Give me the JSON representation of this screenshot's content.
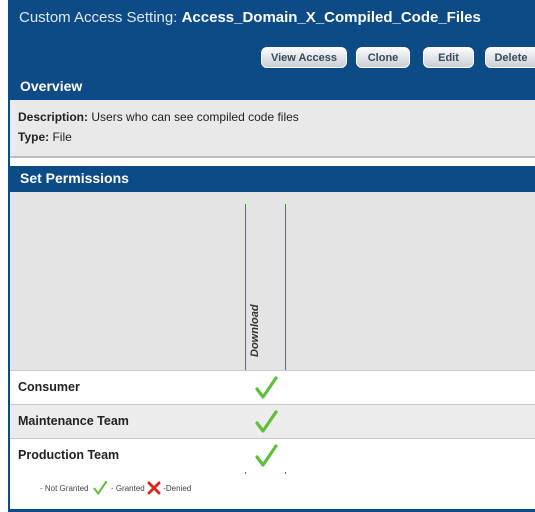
{
  "window": {
    "title_prefix": "Custom Access Setting: ",
    "title_name": "Access_Domain_X_Compiled_Code_Files"
  },
  "toolbar": {
    "view_access": "View Access",
    "clone": "Clone",
    "edit": "Edit",
    "delete": "Delete"
  },
  "overview": {
    "header": "Overview",
    "description_label": "Description:",
    "description_value": "Users who can see compiled code files",
    "type_label": "Type:",
    "type_value": "File"
  },
  "permissions": {
    "header": "Set Permissions",
    "column": "Download",
    "rows": [
      {
        "label": "Consumer",
        "download": "granted"
      },
      {
        "label": "Maintenance Team",
        "download": "granted"
      },
      {
        "label": "Production Team",
        "download": "granted"
      }
    ]
  },
  "legend": {
    "not_granted": "- Not Granted",
    "granted": "- Granted",
    "denied": "-Denied"
  },
  "colors": {
    "header_blue": "#0d4b86",
    "granted_green": "#5fbf3c",
    "denied_red": "#d62b1e"
  },
  "icons": {
    "granted": "check-icon",
    "denied": "x-icon"
  }
}
